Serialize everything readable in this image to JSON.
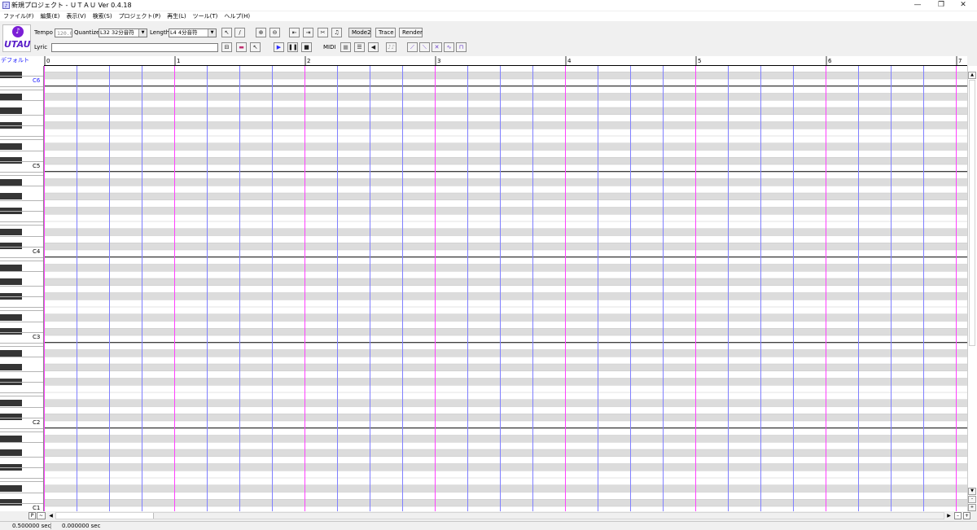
{
  "window": {
    "title": "新規プロジェクト - ＵＴＡＵ Ver 0.4.18",
    "icon": "utau-app-icon",
    "controls": [
      "—",
      "❐",
      "✕"
    ]
  },
  "menu": [
    "ファイル(F)",
    "編集(E)",
    "表示(V)",
    "検索(S)",
    "プロジェクト(P)",
    "再生(L)",
    "ツール(T)",
    "ヘルプ(H)"
  ],
  "toolbar": {
    "logo_text": "UTAU",
    "tempo_label": "Tempo",
    "tempo_value": "120.0",
    "quantize_label": "Quantize",
    "quantize_value": "L32 32分音符",
    "length_label": "Length",
    "length_value": "L4  4分音符",
    "lyric_label": "Lyric",
    "lyric_value": "",
    "mode2_label": "Mode2",
    "trace_label": "Trace",
    "render_label": "Render",
    "midi_label": "MIDI",
    "play_color": "#2a2aff"
  },
  "track": {
    "name": "デフォルト"
  },
  "ruler": {
    "measures": [
      "0",
      "1",
      "2",
      "3",
      "4",
      "5",
      "6",
      "7"
    ]
  },
  "piano": {
    "octaves": [
      "C6",
      "C5",
      "C4",
      "C3",
      "C2",
      "C1"
    ],
    "highlight_octave": "C6",
    "highlight_color": "#1a1aff"
  },
  "grid_colors": {
    "measure_line": "#ff40ff",
    "beat_line": "#8080ff",
    "black_key_row": "#dcdcdc",
    "octave_line": "#000000"
  },
  "scroll": {
    "p_label": "P",
    "tilde_label": "~"
  },
  "status": {
    "left": "0.500000 sec",
    "right": "0.000000 sec"
  }
}
